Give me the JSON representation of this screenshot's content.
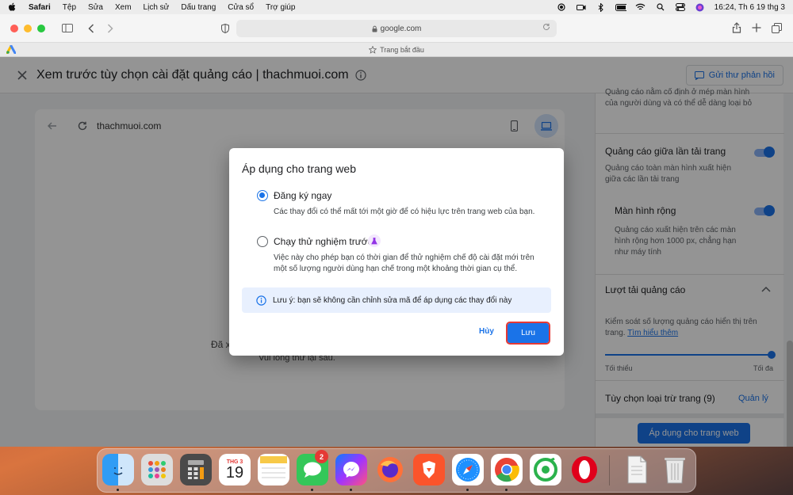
{
  "menubar": {
    "app": "Safari",
    "items": [
      "Tệp",
      "Sửa",
      "Xem",
      "Lịch sử",
      "Dấu trang",
      "Cửa sổ",
      "Trợ giúp"
    ],
    "clock": "16:24, Th 6 19 thg 3"
  },
  "browser": {
    "url": "google.com",
    "tab_label": "Trang bắt đầu"
  },
  "page": {
    "title": "Xem trước tùy chọn cài đặt quảng cáo | thachmuoi.com",
    "feedback_label": "Gửi thư phản hồi",
    "preview_domain": "thachmuoi.com",
    "preview_msg1": "Đã x",
    "preview_msg2": "Vui lòng thử lại sau."
  },
  "sidebar": {
    "top_text": "Quảng cáo nằm cố định ở mép màn hình của người dùng và có thể dễ dàng loại bỏ",
    "interstitial_title": "Quảng cáo giữa lần tải trang",
    "interstitial_desc": "Quảng cáo toàn màn hình xuất hiện giữa các lần tải trang",
    "wide_title": "Màn hình rộng",
    "wide_desc": "Quảng cáo xuất hiện trên các màn hình rộng hơn 1000 px, chẳng hạn như máy tính",
    "load_title": "Lượt tải quảng cáo",
    "load_desc": "Kiểm soát số lượng quảng cáo hiển thị trên trang.",
    "learn_more": "Tìm hiểu thêm",
    "min_label": "Tối thiểu",
    "max_label": "Tối đa",
    "exclusion_title": "Tùy chọn loại trừ trang (9)",
    "manage_label": "Quản lý",
    "apply_button": "Áp dụng cho trang web",
    "ad_load_level": 1.0
  },
  "dialog": {
    "title": "Áp dụng cho trang web",
    "option1_label": "Đăng ký ngay",
    "option1_desc": "Các thay đổi có thể mất tới một giờ để có hiệu lực trên trang web của bạn.",
    "option2_label": "Chạy thử nghiệm trước",
    "option2_desc": "Việc này cho phép bạn có thời gian để thử nghiệm chế độ cài đặt mới trên một số lượng người dùng hạn chế trong một khoảng thời gian cụ thể.",
    "note": "Lưu ý: bạn sẽ không cần chỉnh sửa mã để áp dụng các thay đổi này",
    "cancel_label": "Hủy",
    "save_label": "Lưu",
    "selected_option": "option1"
  },
  "dock": {
    "calendar_month": "THG 3",
    "calendar_day": "19",
    "messages_badge": "2"
  },
  "colors": {
    "accent": "#1a73e8",
    "highlight_border": "#e53935"
  }
}
